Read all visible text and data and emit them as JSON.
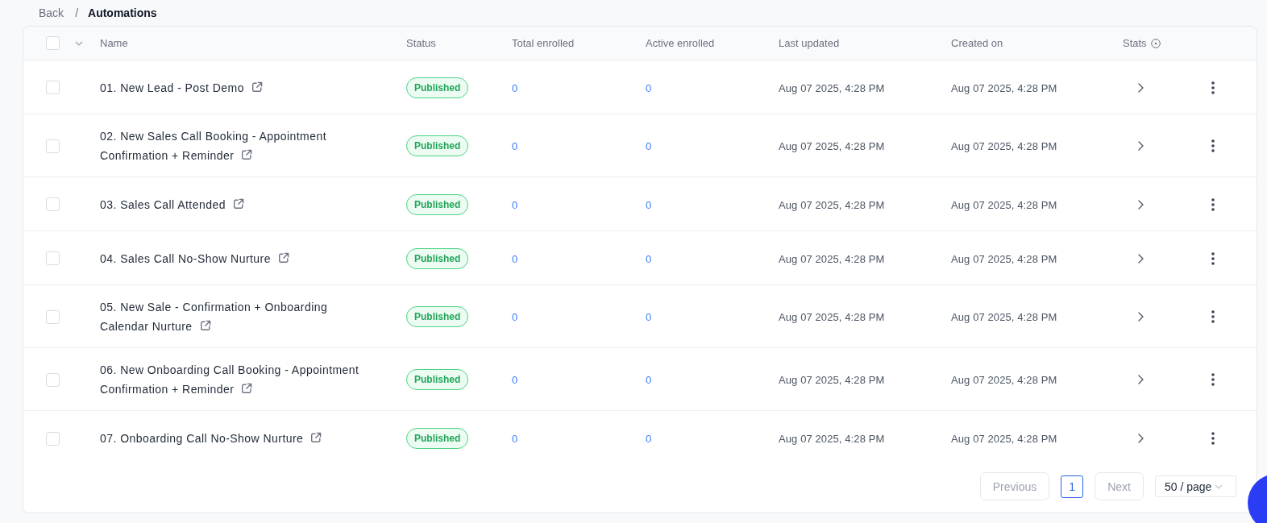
{
  "breadcrumb": {
    "items": [
      {
        "label": "Back",
        "current": false
      },
      {
        "label": "Automations",
        "current": true
      }
    ],
    "separator": "/"
  },
  "table": {
    "select_all": {
      "checked": false
    },
    "columns": [
      {
        "label": "Name",
        "info_icon": false
      },
      {
        "label": "Status",
        "info_icon": false
      },
      {
        "label": "Total enrolled",
        "info_icon": false
      },
      {
        "label": "Active enrolled",
        "info_icon": false
      },
      {
        "label": "Last updated",
        "info_icon": false
      },
      {
        "label": "Created on",
        "info_icon": false
      },
      {
        "label": "Stats",
        "info_icon": true
      }
    ],
    "rows": [
      {
        "checked": false,
        "name": "01. New Lead - Post Demo",
        "status": "Published",
        "total_enrolled": "0",
        "active_enrolled": "0",
        "last_updated": "Aug 07 2025, 4:28 PM",
        "created_on": "Aug 07 2025, 4:28 PM"
      },
      {
        "checked": false,
        "name": "02. New Sales Call Booking - Appointment Confirmation + Reminder",
        "status": "Published",
        "total_enrolled": "0",
        "active_enrolled": "0",
        "last_updated": "Aug 07 2025, 4:28 PM",
        "created_on": "Aug 07 2025, 4:28 PM"
      },
      {
        "checked": false,
        "name": "03. Sales Call Attended",
        "status": "Published",
        "total_enrolled": "0",
        "active_enrolled": "0",
        "last_updated": "Aug 07 2025, 4:28 PM",
        "created_on": "Aug 07 2025, 4:28 PM"
      },
      {
        "checked": false,
        "name": "04. Sales Call No-Show Nurture",
        "status": "Published",
        "total_enrolled": "0",
        "active_enrolled": "0",
        "last_updated": "Aug 07 2025, 4:28 PM",
        "created_on": "Aug 07 2025, 4:28 PM"
      },
      {
        "checked": false,
        "name": "05. New Sale - Confirmation + Onboarding Calendar Nurture",
        "status": "Published",
        "total_enrolled": "0",
        "active_enrolled": "0",
        "last_updated": "Aug 07 2025, 4:28 PM",
        "created_on": "Aug 07 2025, 4:28 PM"
      },
      {
        "checked": false,
        "name": "06. New Onboarding Call Booking - Appointment Confirmation + Reminder",
        "status": "Published",
        "total_enrolled": "0",
        "active_enrolled": "0",
        "last_updated": "Aug 07 2025, 4:28 PM",
        "created_on": "Aug 07 2025, 4:28 PM"
      },
      {
        "checked": false,
        "name": "07. Onboarding Call No-Show Nurture",
        "status": "Published",
        "total_enrolled": "0",
        "active_enrolled": "0",
        "last_updated": "Aug 07 2025, 4:28 PM",
        "created_on": "Aug 07 2025, 4:28 PM"
      }
    ]
  },
  "pagination": {
    "previous": {
      "label": "Previous",
      "disabled": true
    },
    "pages": [
      {
        "label": "1",
        "selected": true
      }
    ],
    "next": {
      "label": "Next",
      "disabled": true
    },
    "page_size": "50 / page"
  }
}
